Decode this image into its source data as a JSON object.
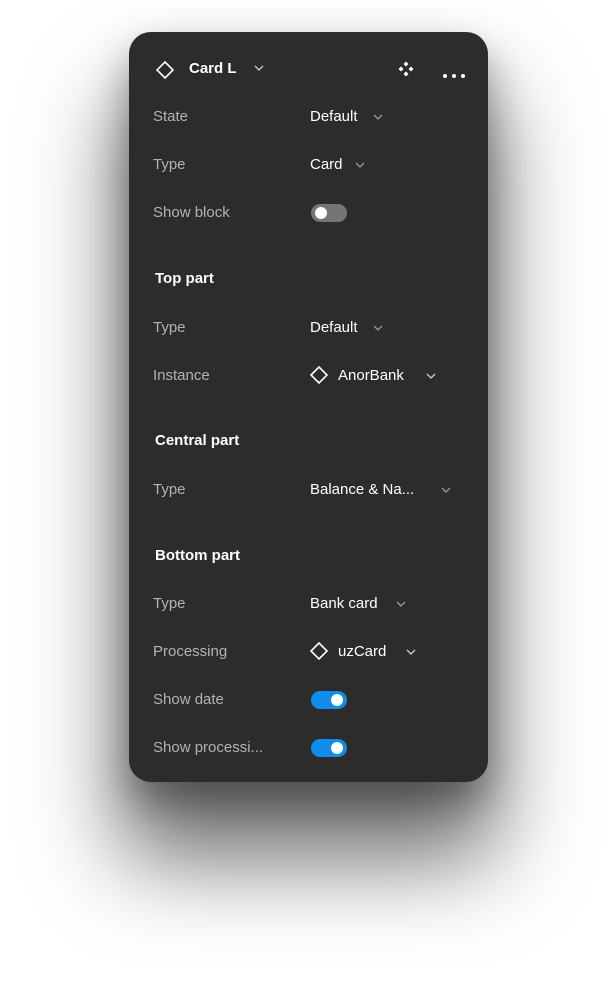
{
  "panel": {
    "title": "Card L",
    "rows_top": [
      {
        "label": "State",
        "value": "Default"
      },
      {
        "label": "Type",
        "value": "Card"
      },
      {
        "label": "Show block"
      }
    ],
    "top_part": {
      "heading": "Top part",
      "type_label": "Type",
      "type_value": "Default",
      "instance_label": "Instance",
      "instance_value": "AnorBank"
    },
    "central_part": {
      "heading": "Central part",
      "type_label": "Type",
      "type_value": "Balance & Na..."
    },
    "bottom_part": {
      "heading": "Bottom part",
      "type_label": "Type",
      "type_value": "Bank card",
      "processing_label": "Processing",
      "processing_value": "uzCard",
      "show_date_label": "Show date",
      "show_processing_label": "Show processi..."
    },
    "toggles": {
      "show_block": false,
      "show_date": true,
      "show_processing": true
    },
    "icons": {
      "title": "component-instance-icon",
      "actions": [
        "component-icon",
        "more-icon"
      ]
    },
    "colors": {
      "panel_bg": "#2c2c2c",
      "accent": "#0d8ce9",
      "label": "#b3b3b3"
    }
  }
}
